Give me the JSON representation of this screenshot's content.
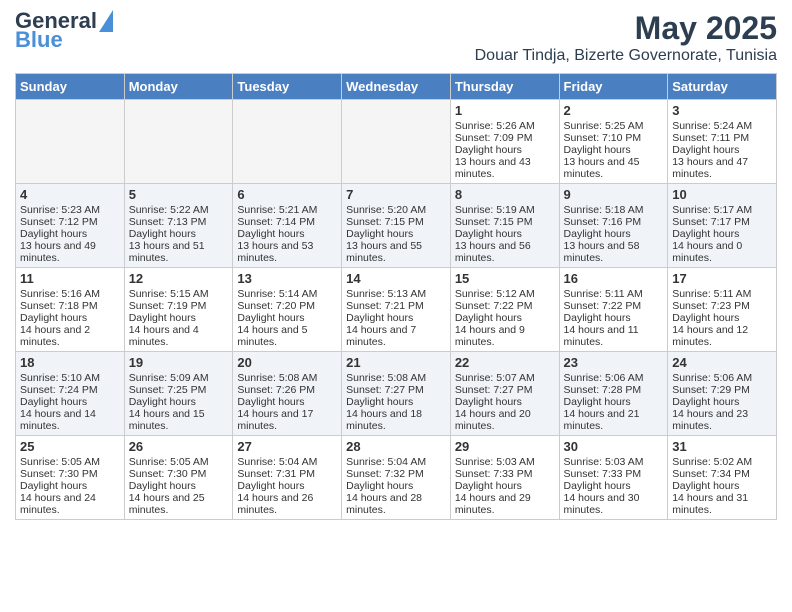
{
  "header": {
    "logo_line1": "General",
    "logo_line2": "Blue",
    "title": "May 2025",
    "subtitle": "Douar Tindja, Bizerte Governorate, Tunisia"
  },
  "weekdays": [
    "Sunday",
    "Monday",
    "Tuesday",
    "Wednesday",
    "Thursday",
    "Friday",
    "Saturday"
  ],
  "weeks": [
    [
      {
        "day": "",
        "empty": true
      },
      {
        "day": "",
        "empty": true
      },
      {
        "day": "",
        "empty": true
      },
      {
        "day": "",
        "empty": true
      },
      {
        "day": "1",
        "sunrise": "5:26 AM",
        "sunset": "7:09 PM",
        "daylight": "13 hours and 43 minutes."
      },
      {
        "day": "2",
        "sunrise": "5:25 AM",
        "sunset": "7:10 PM",
        "daylight": "13 hours and 45 minutes."
      },
      {
        "day": "3",
        "sunrise": "5:24 AM",
        "sunset": "7:11 PM",
        "daylight": "13 hours and 47 minutes."
      }
    ],
    [
      {
        "day": "4",
        "sunrise": "5:23 AM",
        "sunset": "7:12 PM",
        "daylight": "13 hours and 49 minutes."
      },
      {
        "day": "5",
        "sunrise": "5:22 AM",
        "sunset": "7:13 PM",
        "daylight": "13 hours and 51 minutes."
      },
      {
        "day": "6",
        "sunrise": "5:21 AM",
        "sunset": "7:14 PM",
        "daylight": "13 hours and 53 minutes."
      },
      {
        "day": "7",
        "sunrise": "5:20 AM",
        "sunset": "7:15 PM",
        "daylight": "13 hours and 55 minutes."
      },
      {
        "day": "8",
        "sunrise": "5:19 AM",
        "sunset": "7:15 PM",
        "daylight": "13 hours and 56 minutes."
      },
      {
        "day": "9",
        "sunrise": "5:18 AM",
        "sunset": "7:16 PM",
        "daylight": "13 hours and 58 minutes."
      },
      {
        "day": "10",
        "sunrise": "5:17 AM",
        "sunset": "7:17 PM",
        "daylight": "14 hours and 0 minutes."
      }
    ],
    [
      {
        "day": "11",
        "sunrise": "5:16 AM",
        "sunset": "7:18 PM",
        "daylight": "14 hours and 2 minutes."
      },
      {
        "day": "12",
        "sunrise": "5:15 AM",
        "sunset": "7:19 PM",
        "daylight": "14 hours and 4 minutes."
      },
      {
        "day": "13",
        "sunrise": "5:14 AM",
        "sunset": "7:20 PM",
        "daylight": "14 hours and 5 minutes."
      },
      {
        "day": "14",
        "sunrise": "5:13 AM",
        "sunset": "7:21 PM",
        "daylight": "14 hours and 7 minutes."
      },
      {
        "day": "15",
        "sunrise": "5:12 AM",
        "sunset": "7:22 PM",
        "daylight": "14 hours and 9 minutes."
      },
      {
        "day": "16",
        "sunrise": "5:11 AM",
        "sunset": "7:22 PM",
        "daylight": "14 hours and 11 minutes."
      },
      {
        "day": "17",
        "sunrise": "5:11 AM",
        "sunset": "7:23 PM",
        "daylight": "14 hours and 12 minutes."
      }
    ],
    [
      {
        "day": "18",
        "sunrise": "5:10 AM",
        "sunset": "7:24 PM",
        "daylight": "14 hours and 14 minutes."
      },
      {
        "day": "19",
        "sunrise": "5:09 AM",
        "sunset": "7:25 PM",
        "daylight": "14 hours and 15 minutes."
      },
      {
        "day": "20",
        "sunrise": "5:08 AM",
        "sunset": "7:26 PM",
        "daylight": "14 hours and 17 minutes."
      },
      {
        "day": "21",
        "sunrise": "5:08 AM",
        "sunset": "7:27 PM",
        "daylight": "14 hours and 18 minutes."
      },
      {
        "day": "22",
        "sunrise": "5:07 AM",
        "sunset": "7:27 PM",
        "daylight": "14 hours and 20 minutes."
      },
      {
        "day": "23",
        "sunrise": "5:06 AM",
        "sunset": "7:28 PM",
        "daylight": "14 hours and 21 minutes."
      },
      {
        "day": "24",
        "sunrise": "5:06 AM",
        "sunset": "7:29 PM",
        "daylight": "14 hours and 23 minutes."
      }
    ],
    [
      {
        "day": "25",
        "sunrise": "5:05 AM",
        "sunset": "7:30 PM",
        "daylight": "14 hours and 24 minutes."
      },
      {
        "day": "26",
        "sunrise": "5:05 AM",
        "sunset": "7:30 PM",
        "daylight": "14 hours and 25 minutes."
      },
      {
        "day": "27",
        "sunrise": "5:04 AM",
        "sunset": "7:31 PM",
        "daylight": "14 hours and 26 minutes."
      },
      {
        "day": "28",
        "sunrise": "5:04 AM",
        "sunset": "7:32 PM",
        "daylight": "14 hours and 28 minutes."
      },
      {
        "day": "29",
        "sunrise": "5:03 AM",
        "sunset": "7:33 PM",
        "daylight": "14 hours and 29 minutes."
      },
      {
        "day": "30",
        "sunrise": "5:03 AM",
        "sunset": "7:33 PM",
        "daylight": "14 hours and 30 minutes."
      },
      {
        "day": "31",
        "sunrise": "5:02 AM",
        "sunset": "7:34 PM",
        "daylight": "14 hours and 31 minutes."
      }
    ]
  ],
  "labels": {
    "sunrise_prefix": "Sunrise: ",
    "sunset_prefix": "Sunset: ",
    "daylight_prefix": "Daylight: "
  }
}
